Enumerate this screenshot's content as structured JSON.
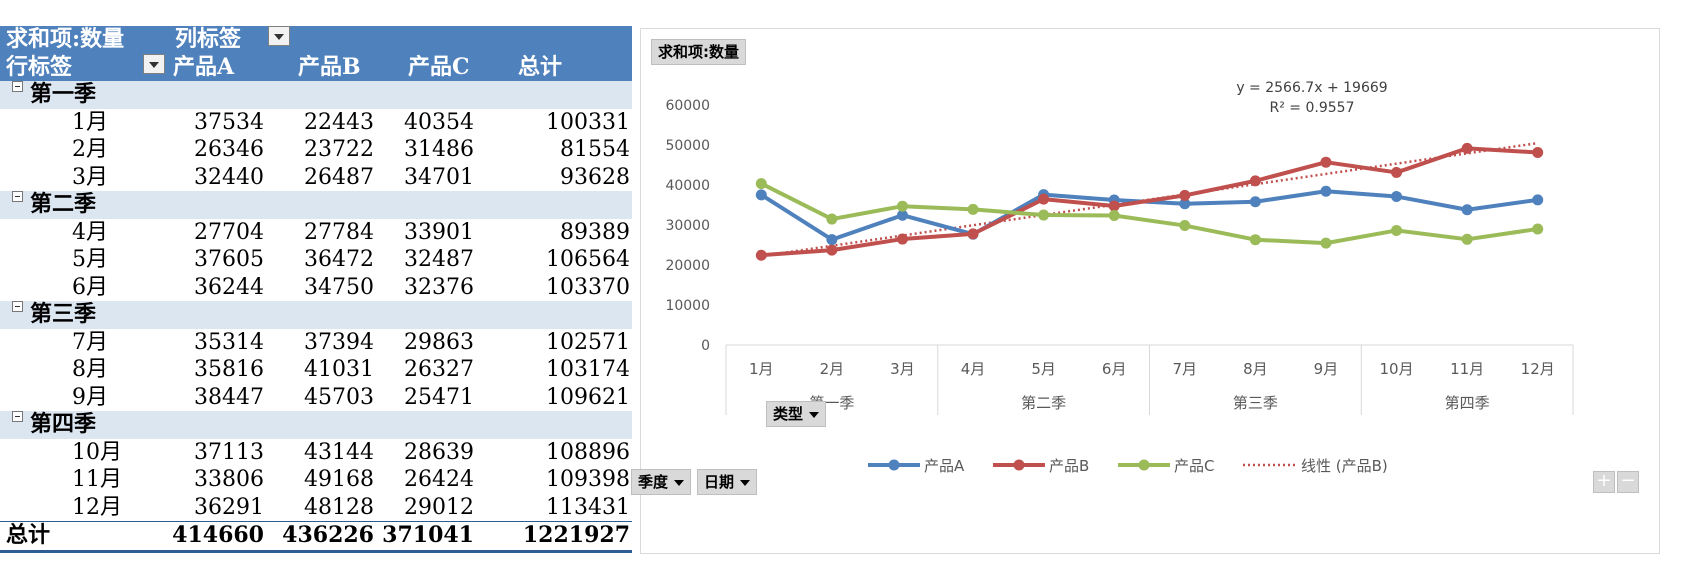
{
  "pivot": {
    "header_value_field": "求和项:数量",
    "header_col_label": "列标签",
    "header_row_label": "行标签",
    "columns": [
      "产品A",
      "产品B",
      "产品C",
      "总计"
    ],
    "groups": [
      {
        "name": "第一季",
        "rows": [
          {
            "month": "1月",
            "a": "37534",
            "b": "22443",
            "c": "40354",
            "t": "100331"
          },
          {
            "month": "2月",
            "a": "26346",
            "b": "23722",
            "c": "31486",
            "t": "81554"
          },
          {
            "month": "3月",
            "a": "32440",
            "b": "26487",
            "c": "34701",
            "t": "93628"
          }
        ]
      },
      {
        "name": "第二季",
        "rows": [
          {
            "month": "4月",
            "a": "27704",
            "b": "27784",
            "c": "33901",
            "t": "89389"
          },
          {
            "month": "5月",
            "a": "37605",
            "b": "36472",
            "c": "32487",
            "t": "106564"
          },
          {
            "month": "6月",
            "a": "36244",
            "b": "34750",
            "c": "32376",
            "t": "103370"
          }
        ]
      },
      {
        "name": "第三季",
        "rows": [
          {
            "month": "7月",
            "a": "35314",
            "b": "37394",
            "c": "29863",
            "t": "102571"
          },
          {
            "month": "8月",
            "a": "35816",
            "b": "41031",
            "c": "26327",
            "t": "103174"
          },
          {
            "month": "9月",
            "a": "38447",
            "b": "45703",
            "c": "25471",
            "t": "109621"
          }
        ]
      },
      {
        "name": "第四季",
        "rows": [
          {
            "month": "10月",
            "a": "37113",
            "b": "43144",
            "c": "28639",
            "t": "108896"
          },
          {
            "month": "11月",
            "a": "33806",
            "b": "49168",
            "c": "26424",
            "t": "109398"
          },
          {
            "month": "12月",
            "a": "36291",
            "b": "48128",
            "c": "29012",
            "t": "113431"
          }
        ]
      }
    ],
    "total": {
      "label": "总计",
      "a": "414660",
      "b": "436226",
      "c": "371041",
      "t": "1221927"
    }
  },
  "chart_buttons": {
    "value_field": "求和项:数量",
    "legend_field": "类型",
    "axis_field_1": "季度",
    "axis_field_2": "日期",
    "zoom_in": "+",
    "zoom_out": "−"
  },
  "chart_data": {
    "type": "line",
    "categories": [
      "1月",
      "2月",
      "3月",
      "4月",
      "5月",
      "6月",
      "7月",
      "8月",
      "9月",
      "10月",
      "11月",
      "12月"
    ],
    "category_groups": [
      {
        "label": "第一季",
        "span": 3
      },
      {
        "label": "第二季",
        "span": 3
      },
      {
        "label": "第三季",
        "span": 3
      },
      {
        "label": "第四季",
        "span": 3
      }
    ],
    "ylim": [
      0,
      60000
    ],
    "yticks": [
      0,
      10000,
      20000,
      30000,
      40000,
      50000,
      60000
    ],
    "grid": false,
    "legend_position": "bottom",
    "series": [
      {
        "name": "产品A",
        "color": "#4f81bd",
        "values": [
          37534,
          26346,
          32440,
          27704,
          37605,
          36244,
          35314,
          35816,
          38447,
          37113,
          33806,
          36291
        ]
      },
      {
        "name": "产品B",
        "color": "#c0504d",
        "values": [
          22443,
          23722,
          26487,
          27784,
          36472,
          34750,
          37394,
          41031,
          45703,
          43144,
          49168,
          48128
        ]
      },
      {
        "name": "产品C",
        "color": "#9bbb59",
        "values": [
          40354,
          31486,
          34701,
          33901,
          32487,
          32376,
          29863,
          26327,
          25471,
          28639,
          26424,
          29012
        ]
      }
    ],
    "trendline": {
      "name": "线性 (产品B)",
      "color": "#c0504d",
      "slope": 2566.7,
      "intercept": 19669,
      "equation": "y = 2566.7x + 19669",
      "r2": "R² = 0.9557"
    }
  }
}
